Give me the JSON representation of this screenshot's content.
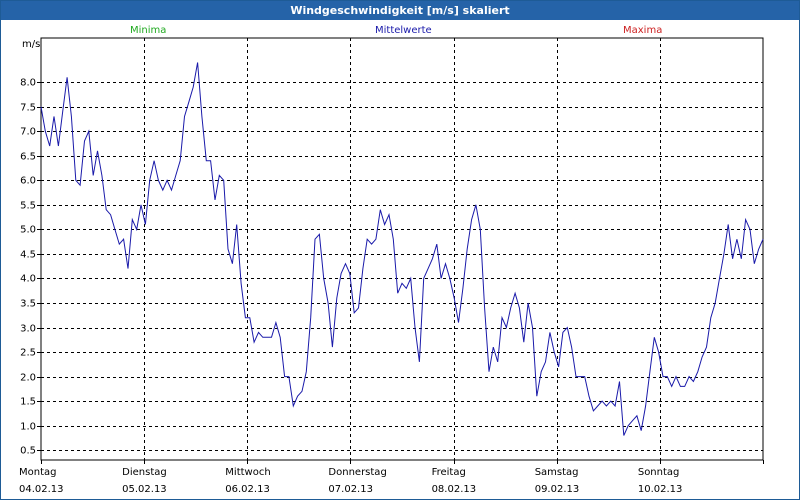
{
  "title": "Windgeschwindigkeit [m/s] skaliert",
  "legend": {
    "minima": {
      "label": "Minima",
      "color": "#22aa22"
    },
    "mittelwerte": {
      "label": "Mittelwerte",
      "color": "#1a1aaa"
    },
    "maxima": {
      "label": "Maxima",
      "color": "#cc2222"
    }
  },
  "chart_data": {
    "type": "line",
    "title": "Windgeschwindigkeit [m/s] skaliert",
    "ylabel": "m/s",
    "ylim": [
      0.3,
      8.9
    ],
    "yticks": [
      "0.5",
      "1.0",
      "1.5",
      "2.0",
      "2.5",
      "3.0",
      "3.5",
      "4.0",
      "4.5",
      "5.0",
      "5.5",
      "6.0",
      "6.5",
      "7.0",
      "7.5",
      "8.0"
    ],
    "grid": true,
    "x_categories": [
      {
        "day": "Montag",
        "date": "04.02.13"
      },
      {
        "day": "Dienstag",
        "date": "05.02.13"
      },
      {
        "day": "Mittwoch",
        "date": "06.02.13"
      },
      {
        "day": "Donnerstag",
        "date": "07.02.13"
      },
      {
        "day": "Freitag",
        "date": "08.02.13"
      },
      {
        "day": "Samstag",
        "date": "09.02.13"
      },
      {
        "day": "Sonntag",
        "date": "10.02.13"
      }
    ],
    "series": [
      {
        "name": "Mittelwerte",
        "color": "#1a1aaa",
        "x_start_day": 0,
        "x_step_hours": 1,
        "values": [
          7.5,
          7.0,
          6.7,
          7.3,
          6.7,
          7.4,
          8.1,
          7.3,
          6.0,
          5.9,
          6.8,
          7.0,
          6.1,
          6.6,
          6.1,
          5.4,
          5.3,
          5.0,
          4.7,
          4.8,
          4.2,
          5.2,
          5.0,
          5.5,
          5.1,
          6.0,
          6.4,
          6.0,
          5.8,
          6.0,
          5.8,
          6.1,
          6.4,
          7.3,
          7.6,
          7.9,
          8.4,
          7.3,
          6.4,
          6.4,
          5.6,
          6.1,
          6.0,
          4.6,
          4.3,
          5.1,
          3.9,
          3.2,
          3.2,
          2.7,
          2.9,
          2.8,
          2.8,
          2.8,
          3.1,
          2.8,
          2.0,
          2.0,
          1.4,
          1.6,
          1.7,
          2.1,
          3.2,
          4.8,
          4.9,
          4.0,
          3.5,
          2.6,
          3.6,
          4.1,
          4.3,
          4.1,
          3.3,
          3.4,
          4.2,
          4.8,
          4.7,
          4.8,
          5.4,
          5.1,
          5.3,
          4.8,
          3.7,
          3.9,
          3.8,
          4.0,
          3.0,
          2.3,
          4.0,
          4.2,
          4.4,
          4.7,
          4.0,
          4.3,
          4.0,
          3.6,
          3.1,
          3.8,
          4.6,
          5.2,
          5.5,
          5.0,
          3.4,
          2.1,
          2.6,
          2.3,
          3.2,
          3.0,
          3.4,
          3.7,
          3.4,
          2.7,
          3.5,
          3.0,
          1.6,
          2.1,
          2.3,
          2.9,
          2.5,
          2.2,
          2.9,
          3.0,
          2.6,
          2.0,
          2.0,
          2.0,
          1.6,
          1.3,
          1.4,
          1.5,
          1.4,
          1.5,
          1.4,
          1.9,
          0.8,
          1.0,
          1.1,
          1.2,
          0.9,
          1.4,
          2.1,
          2.8,
          2.5,
          2.0,
          2.0,
          1.8,
          2.0,
          1.8,
          1.8,
          2.0,
          1.9,
          2.1,
          2.4,
          2.6,
          3.2,
          3.5,
          4.0,
          4.5,
          5.1,
          4.4,
          4.8,
          4.4,
          5.2,
          5.0,
          4.3,
          4.6,
          4.8
        ]
      }
    ]
  }
}
